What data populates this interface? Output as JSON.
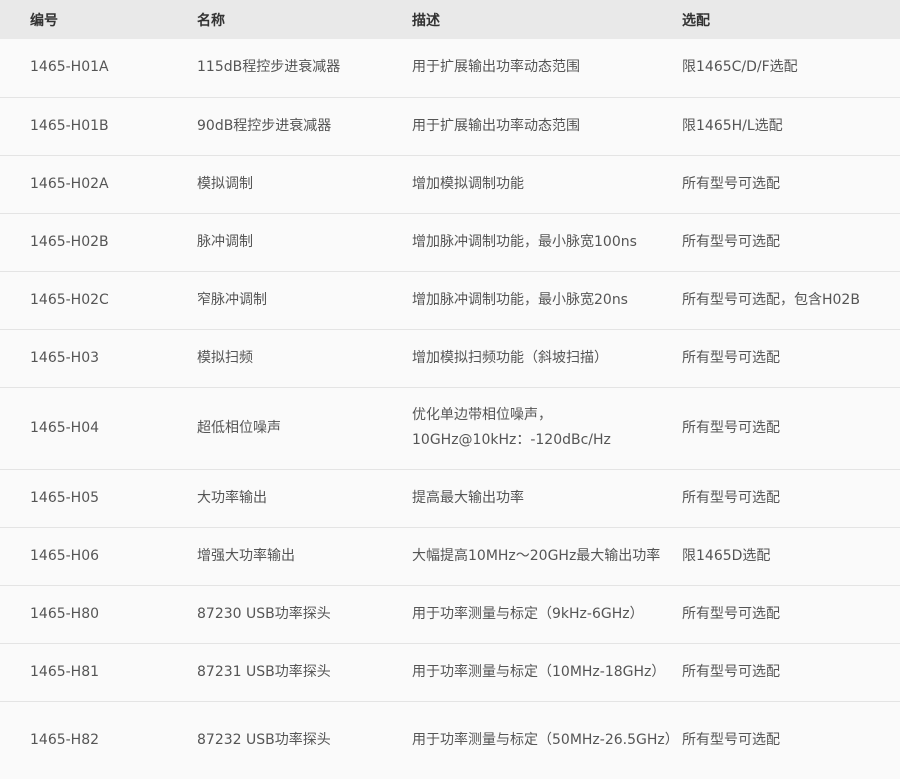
{
  "table": {
    "headers": [
      "编号",
      "名称",
      "描述",
      "选配"
    ],
    "rows": [
      [
        "1465-H01A",
        "115dB程控步进衰减器",
        "用于扩展输出功率动态范围",
        "限1465C/D/F选配"
      ],
      [
        "1465-H01B",
        "90dB程控步进衰减器",
        "用于扩展输出功率动态范围",
        "限1465H/L选配"
      ],
      [
        "1465-H02A",
        "模拟调制",
        "增加模拟调制功能",
        "所有型号可选配"
      ],
      [
        "1465-H02B",
        "脉冲调制",
        "增加脉冲调制功能，最小脉宽100ns",
        "所有型号可选配"
      ],
      [
        "1465-H02C",
        "窄脉冲调制",
        "增加脉冲调制功能，最小脉宽20ns",
        "所有型号可选配，包含H02B"
      ],
      [
        "1465-H03",
        "模拟扫频",
        "增加模拟扫频功能（斜坡扫描）",
        "所有型号可选配"
      ],
      [
        "1465-H04",
        "超低相位噪声",
        "优化单边带相位噪声，10GHz@10kHz：-120dBc/Hz",
        "所有型号可选配"
      ],
      [
        "1465-H05",
        "大功率输出",
        "提高最大输出功率",
        "所有型号可选配"
      ],
      [
        "1465-H06",
        "增强大功率输出",
        "大幅提高10MHz～20GHz最大输出功率",
        "限1465D选配"
      ],
      [
        "1465-H80",
        "87230 USB功率探头",
        "用于功率测量与标定（9kHz-6GHz）",
        "所有型号可选配"
      ],
      [
        "1465-H81",
        "87231 USB功率探头",
        "用于功率测量与标定（10MHz-18GHz）",
        "所有型号可选配"
      ],
      [
        "1465-H82",
        "87232 USB功率探头",
        "用于功率测量与标定（50MHz-26.5GHz）",
        "所有型号可选配"
      ]
    ]
  }
}
